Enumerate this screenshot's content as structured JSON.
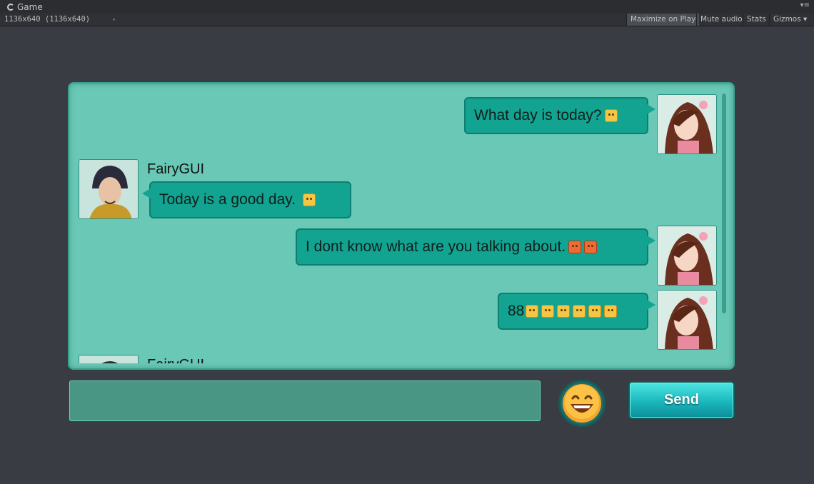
{
  "editor": {
    "tab_title": "Game",
    "resolution": "1136x640 (1136x640)",
    "toolbar": {
      "maximize": "Maximize on Play",
      "mute": "Mute audio",
      "stats": "Stats",
      "gizmos": "Gizmos"
    }
  },
  "chat": {
    "messages": [
      {
        "side": "right",
        "text": "What day is today?",
        "emojis": [
          "grin"
        ]
      },
      {
        "side": "left",
        "sender": "FairyGUI",
        "text": "Today is a good day.",
        "emojis": [
          "laugh"
        ]
      },
      {
        "side": "right",
        "text": "I dont know what are you talking about.",
        "emojis": [
          "angry",
          "angry"
        ]
      },
      {
        "side": "right",
        "text": "88",
        "emojis": [
          "wave",
          "wave",
          "wave",
          "wave",
          "wave",
          "wave"
        ]
      }
    ],
    "partial_sender": "FairyGUI"
  },
  "controls": {
    "input_value": "",
    "send_label": "Send",
    "emoji_icon": "smiley-icon"
  },
  "colors": {
    "panel": "#6ac8b6",
    "bubble": "#12a391",
    "send_top": "#4fe6e3",
    "send_bottom": "#0c8e98"
  }
}
